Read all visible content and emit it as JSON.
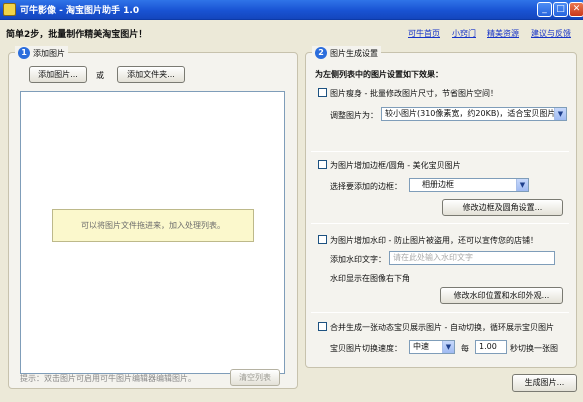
{
  "window": {
    "title": "可牛影像 - 淘宝图片助手 1.0",
    "minimize": "_",
    "maximize": "□",
    "close": "✕"
  },
  "header": {
    "headline": "简单2步，批量制作精美淘宝图片！",
    "links": [
      "可牛首页",
      "小窍门",
      "精美资源",
      "建议与反馈"
    ]
  },
  "left": {
    "step": "1",
    "legend": "添加图片",
    "add_image": "添加图片...",
    "or": "或",
    "add_folder": "添加文件夹...",
    "drop_hint": "可以将图片文件拖进来，加入处理列表。",
    "tip": "提示：双击图片可启用可牛图片编辑器编辑图片。",
    "clear_list": "清空列表"
  },
  "right": {
    "step": "2",
    "legend": "图片生成设置",
    "intro": "为左侧列表中的图片设置如下效果：",
    "slim": {
      "label": "图片瘦身 - 批量修改图片尺寸，节省图片空间！",
      "checked": false,
      "resize_label": "调整图片为：",
      "resize_value": "较小图片(310像素宽，约20KB)，适合宝贝图片",
      "resize_arrow": "▼"
    },
    "border": {
      "label": "为图片增加边框/圆角 - 美化宝贝图片",
      "checked": false,
      "select_label": "选择要添加的边框：",
      "select_value": "相册边框",
      "select_arrow": "▼",
      "settings_button": "修改边框及圆角设置..."
    },
    "watermark": {
      "label": "为图片增加水印 - 防止图片被盗用，还可以宣传您的店铺！",
      "checked": false,
      "text_label": "添加水印文字：",
      "text_placeholder": "请在此处输入水印文字",
      "position_text": "水印显示在图像右下角",
      "settings_button": "修改水印位置和水印外观..."
    },
    "merge": {
      "label": "合并生成一张动态宝贝展示图片 - 自动切换，循环展示宝贝图片",
      "checked": false,
      "speed_label": "宝贝图片切换速度：",
      "speed_value": "中速",
      "speed_arrow": "▼",
      "every": "每",
      "seconds_value": "1.00",
      "seconds_suffix": "秒切换一张图"
    }
  },
  "footer": {
    "generate": "生成图片..."
  },
  "colors": {
    "titlebar": "#1953d3",
    "link": "#1633c8",
    "client_bg": "#ece9d8"
  }
}
